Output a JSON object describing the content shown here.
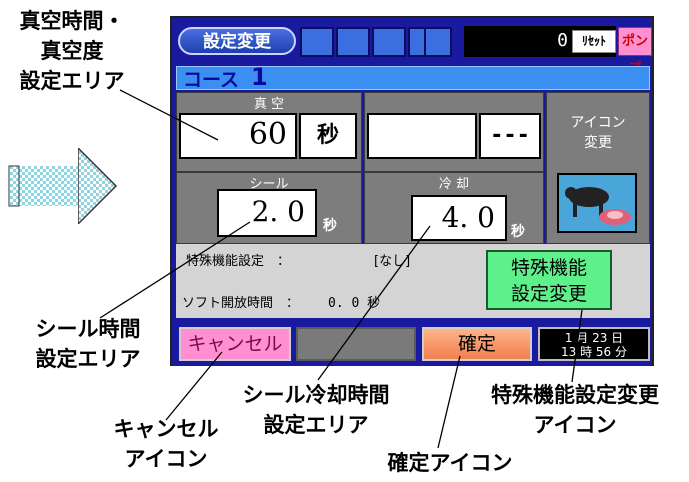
{
  "callouts": {
    "vacuum_area": [
      "真空時間・",
      "真空度",
      "設定エリア"
    ],
    "seal_time_area": [
      "シール時間",
      "設定エリア"
    ],
    "cancel_icon": [
      "キャンセル",
      "アイコン"
    ],
    "seal_cool_area": [
      "シール冷却時間",
      "設定エリア"
    ],
    "confirm_icon": [
      "確定アイコン"
    ],
    "special_func_icon": [
      "特殊機能設定変更",
      "アイコン"
    ]
  },
  "screen": {
    "header": {
      "settings_button": "設定変更",
      "counter_value": "0",
      "reset_button": "ﾘｾｯﾄ",
      "pump_button": "ポンプ"
    },
    "course": {
      "label": "コース",
      "number": "1"
    },
    "vacuum": {
      "title": "真 空",
      "value": "60",
      "unit": "秒",
      "second_unit": "---"
    },
    "icon_change": {
      "line1": "アイコン",
      "line2": "変更",
      "icon": "cow-meat-icon"
    },
    "seal": {
      "title": "シール",
      "value": "2. 0",
      "unit": "秒"
    },
    "cooling": {
      "title": "冷 却",
      "value": "4. 0",
      "unit": "秒"
    },
    "info": {
      "special_label": "特殊機能設定　：",
      "special_value": "[なし]",
      "soft_release_label": "ソフト開放時間　：",
      "soft_release_value": "0. 0 秒"
    },
    "special_button": {
      "line1": "特殊機能",
      "line2": "設定変更"
    },
    "footer": {
      "cancel_button": "キャンセル",
      "confirm_button": "確定",
      "clock_line1": "1 月 23 日",
      "clock_line2": "13 時 56 分"
    }
  },
  "colors": {
    "screen_bg": "#1a1aa0",
    "course_bar": "#3a8ff0",
    "panel": "#7d7d7d",
    "cancel": "#ff8fd0",
    "confirm": "#f08050",
    "special": "#5ef08a"
  }
}
